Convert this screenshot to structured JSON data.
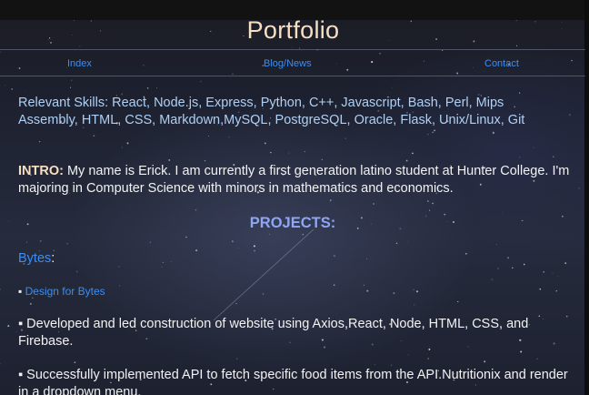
{
  "header": {
    "title": "Portfolio"
  },
  "nav": {
    "items": [
      "Index",
      "Blog/News",
      "Contact"
    ]
  },
  "skills": {
    "text": "Relevant Skills: React, Node.js, Express, Python, C++, Javascript, Bash, Perl, Mips Assembly, HTML, CSS, Markdown,MySQL, PostgreSQL, Oracle, Flask, Unix/Linux, Git"
  },
  "intro": {
    "label": "INTRO:",
    "text": " My name is Erick. I am currently a first generation latino student at Hunter College. I'm majoring in Computer Science with minors in mathematics and economics."
  },
  "projects": {
    "heading": "PROJECTS:",
    "bytes": {
      "name": "Bytes",
      "suffix": ":",
      "bullet": "▪",
      "design_link": "Design for Bytes",
      "items": [
        "▪ Developed and led construction of website using Axios,React, Node, HTML, CSS, and Firebase.",
        "▪ Successfully implemented API to fetch specific food items from the API.Nutritionix and render in a dropdown menu."
      ]
    }
  },
  "colors": {
    "title": "#f7dfc2",
    "link": "#3b8ef0",
    "skills": "#aed0f4",
    "projects_heading": "#8ea6f4"
  }
}
